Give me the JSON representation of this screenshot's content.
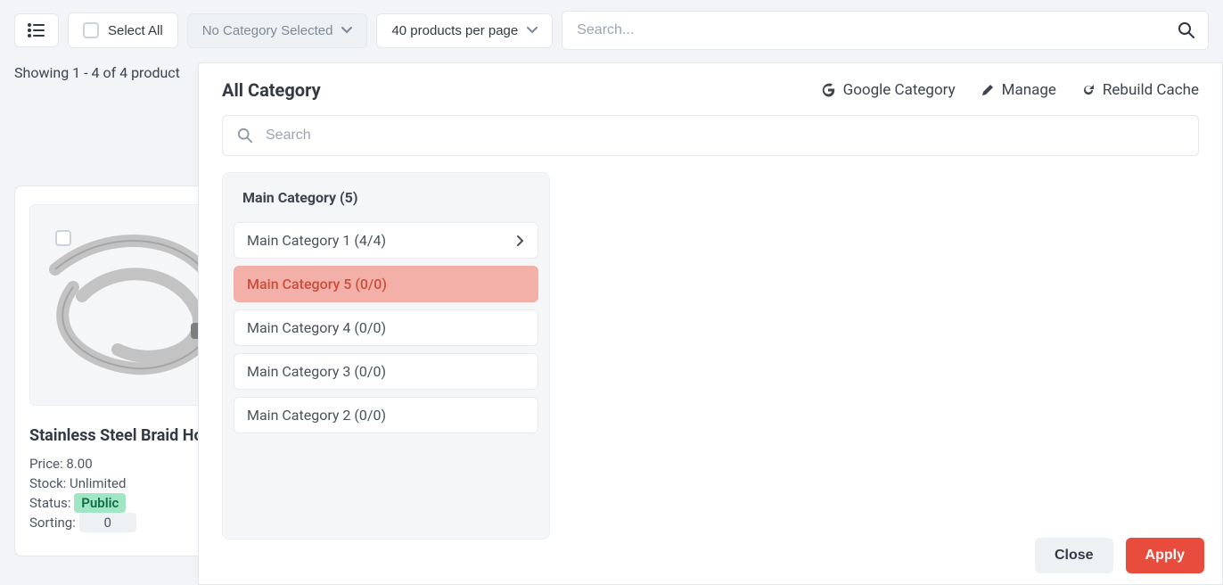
{
  "toolbar": {
    "select_all_label": "Select All",
    "category_filter_label": "No Category Selected",
    "per_page_label": "40 products per page",
    "search_placeholder": "Search..."
  },
  "results": {
    "summary": "Showing 1 - 4 of 4 product"
  },
  "card": {
    "title": "Stainless Steel Braid Hose",
    "price_label": "Price:",
    "price_value": "8.00",
    "stock_label": "Stock:",
    "stock_value": "Unlimited",
    "status_label": "Status:",
    "status_value": "Public",
    "sorting_label": "Sorting:",
    "sorting_value": "0"
  },
  "modal": {
    "title": "All Category",
    "search_placeholder": "Search",
    "actions": {
      "google": "Google Category",
      "manage": "Manage",
      "rebuild": "Rebuild Cache"
    },
    "category_panel": {
      "header": "Main Category (5)",
      "items": [
        {
          "label": "Main Category 1 (4/4)",
          "has_children": true,
          "selected": false
        },
        {
          "label": "Main Category 5 (0/0)",
          "has_children": false,
          "selected": true
        },
        {
          "label": "Main Category 4 (0/0)",
          "has_children": false,
          "selected": false
        },
        {
          "label": "Main Category 3 (0/0)",
          "has_children": false,
          "selected": false
        },
        {
          "label": "Main Category 2 (0/0)",
          "has_children": false,
          "selected": false
        }
      ]
    },
    "footer": {
      "close": "Close",
      "apply": "Apply"
    }
  }
}
